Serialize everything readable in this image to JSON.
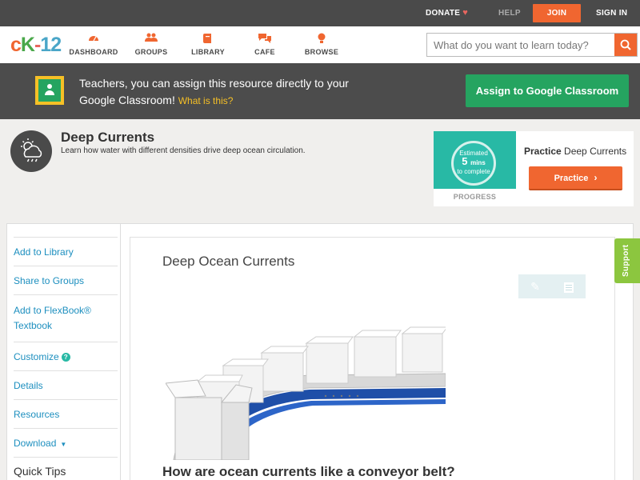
{
  "topbar": {
    "donate": "DONATE",
    "help": "HELP",
    "join": "JOIN",
    "signin": "SIGN IN"
  },
  "nav": {
    "logo": {
      "c": "c",
      "k": "K",
      "dash": "-",
      "num": "12"
    },
    "items": [
      {
        "label": "DASHBOARD",
        "icon": "dashboard-icon"
      },
      {
        "label": "GROUPS",
        "icon": "groups-icon"
      },
      {
        "label": "LIBRARY",
        "icon": "library-icon"
      },
      {
        "label": "CAFE",
        "icon": "cafe-icon"
      },
      {
        "label": "BROWSE",
        "icon": "browse-icon"
      }
    ],
    "search_placeholder": "What do you want to learn today?"
  },
  "banner": {
    "text": "Teachers, you can assign this resource directly to your Google Classroom!",
    "what": "What is this?",
    "button": "Assign to Google Classroom"
  },
  "topic": {
    "title": "Deep Currents",
    "description": "Learn how water with different densities drive deep ocean circulation."
  },
  "practice": {
    "estimated": "Estimated",
    "mins": "5",
    "mins_label": "mins",
    "to_complete": "to complete",
    "progress": "PROGRESS",
    "title_bold": "Practice",
    "title_rest": "Deep Currents",
    "button": "Practice"
  },
  "sidebar": {
    "items": [
      {
        "label": "Add to Library"
      },
      {
        "label": "Share to Groups"
      },
      {
        "label": "Add to FlexBook® Textbook"
      },
      {
        "label": "Customize"
      },
      {
        "label": "Details"
      },
      {
        "label": "Resources"
      },
      {
        "label": "Download"
      }
    ],
    "quick_tips": "Quick Tips"
  },
  "content": {
    "title": "Deep Ocean Currents",
    "question": "How are ocean currents like a conveyor belt?"
  },
  "support": "Support",
  "colors": {
    "accent": "#f06630",
    "green": "#25a460",
    "teal": "#28b9a5",
    "link": "#1d8fbf",
    "support": "#8cc63f"
  }
}
